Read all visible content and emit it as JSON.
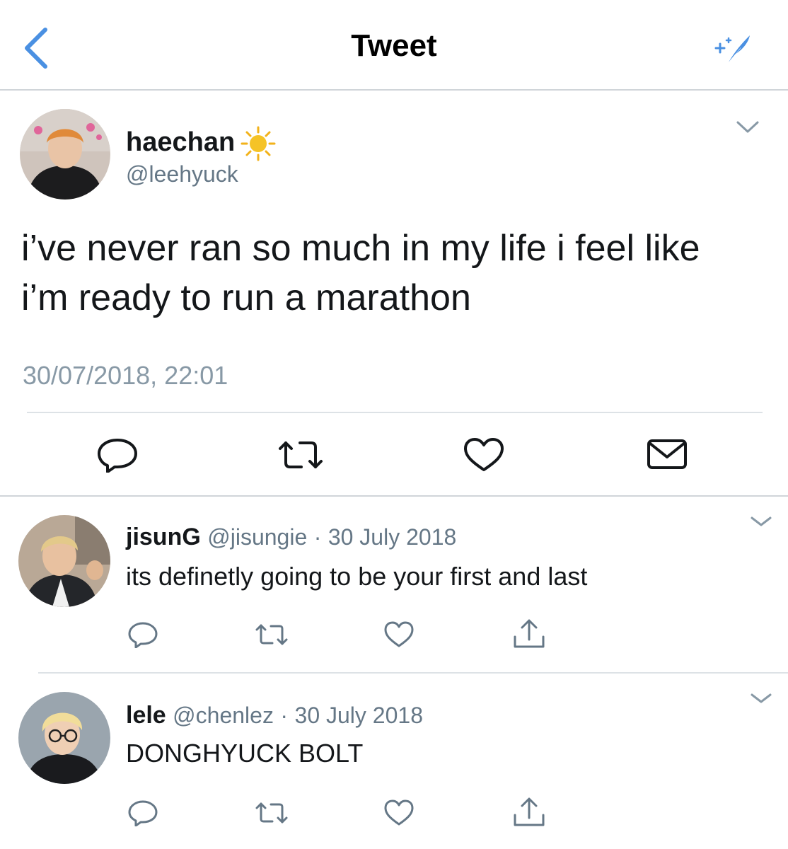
{
  "header": {
    "title": "Tweet"
  },
  "tweet": {
    "name": "haechan",
    "handle": "@leehyuck",
    "text_line1": "i’ve never ran so much in my life i feel like",
    "text_line2": "i’m ready to run a marathon",
    "timestamp": "30/07/2018, 22:01"
  },
  "replies": [
    {
      "name": "jisunG",
      "handle": "@jisungie",
      "separator": "·",
      "date": "30 July 2018",
      "text": "its definetly going to be your first and last"
    },
    {
      "name": "lele",
      "handle": "@chenlez",
      "separator": "·",
      "date": "30 July 2018",
      "text": "DONGHYUCK BOLT"
    }
  ],
  "colors": {
    "accent": "#1da1f2",
    "text": "#14171a",
    "secondary": "#657786",
    "icon": "#657786",
    "main_icon": "#14171a"
  }
}
